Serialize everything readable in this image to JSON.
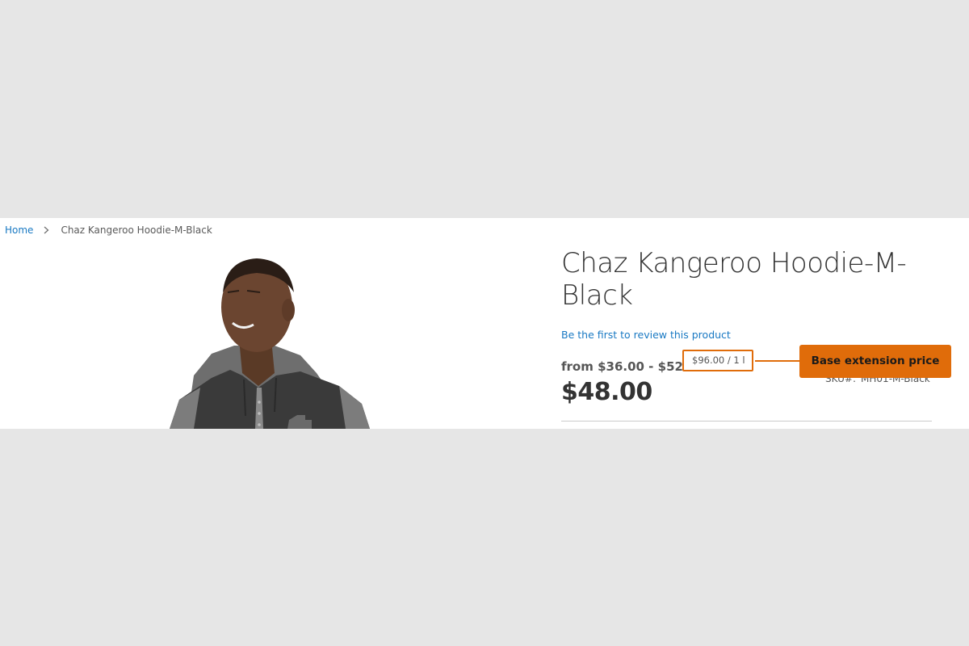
{
  "breadcrumb": {
    "home": "Home",
    "current": "Chaz Kangeroo Hoodie-M-Black"
  },
  "product": {
    "title": "Chaz Kangeroo Hoodie-M-Black",
    "review_link": "Be the first to review this product",
    "price_range": "from $36.00 - $52.00",
    "price": "$48.00",
    "sku_label": "SKU#:",
    "sku_value": "MH01-M-Black",
    "image_icon": "hoodie-model-photo"
  },
  "annotation": {
    "extension_price": "$96.00 / 1 l",
    "label": "Base extension price"
  },
  "colors": {
    "accent": "#e06c0a",
    "link": "#1979c3",
    "background": "#e6e6e6"
  }
}
